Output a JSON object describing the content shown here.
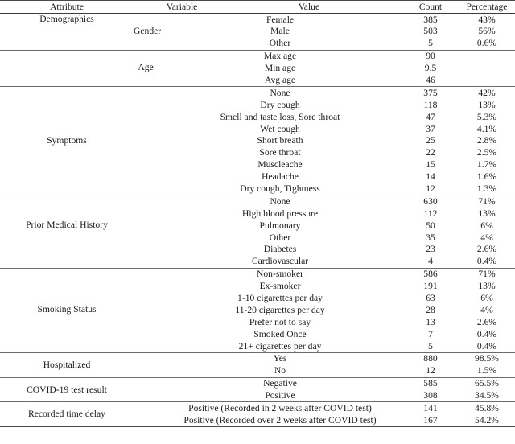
{
  "table": {
    "headers": [
      "Attribute",
      "Variable",
      "Value",
      "Count",
      "Percentage"
    ],
    "sections": [
      {
        "attribute": "Demographics",
        "attribute_row_index": 0,
        "groups": [
          {
            "variable": "Gender",
            "variable_row_index": 1,
            "rows": [
              {
                "value": "Female",
                "count": "385",
                "percentage": "43%"
              },
              {
                "value": "Male",
                "count": "503",
                "percentage": "56%"
              },
              {
                "value": "Other",
                "count": "5",
                "percentage": "0.6%"
              }
            ]
          }
        ]
      },
      {
        "attribute": "",
        "attribute_row_index": -1,
        "groups": [
          {
            "variable": "Age",
            "variable_row_index": 1,
            "rows": [
              {
                "value": "Max age",
                "count": "90",
                "percentage": ""
              },
              {
                "value": "Min age",
                "count": "9.5",
                "percentage": ""
              },
              {
                "value": "Avg age",
                "count": "46",
                "percentage": ""
              }
            ]
          }
        ]
      },
      {
        "attribute": "Symptoms",
        "attribute_row_index": 4,
        "groups": [
          {
            "variable": "",
            "variable_row_index": -1,
            "rows": [
              {
                "value": "None",
                "count": "375",
                "percentage": "42%"
              },
              {
                "value": "Dry cough",
                "count": "118",
                "percentage": "13%"
              },
              {
                "value": "Smell and taste loss, Sore throat",
                "count": "47",
                "percentage": "5.3%"
              },
              {
                "value": "Wet cough",
                "count": "37",
                "percentage": "4.1%"
              },
              {
                "value": "Short breath",
                "count": "25",
                "percentage": "2.8%"
              },
              {
                "value": "Sore throat",
                "count": "22",
                "percentage": "2.5%"
              },
              {
                "value": "Muscleache",
                "count": "15",
                "percentage": "1.7%"
              },
              {
                "value": "Headache",
                "count": "14",
                "percentage": "1.6%"
              },
              {
                "value": "Dry cough, Tightness",
                "count": "12",
                "percentage": "1.3%"
              }
            ]
          }
        ]
      },
      {
        "attribute": "Prior Medical History",
        "attribute_row_index": 2,
        "groups": [
          {
            "variable": "",
            "variable_row_index": -1,
            "rows": [
              {
                "value": "None",
                "count": "630",
                "percentage": "71%"
              },
              {
                "value": "High blood pressure",
                "count": "112",
                "percentage": "13%"
              },
              {
                "value": "Pulmonary",
                "count": "50",
                "percentage": "6%"
              },
              {
                "value": "Other",
                "count": "35",
                "percentage": "4%"
              },
              {
                "value": "Diabetes",
                "count": "23",
                "percentage": "2.6%"
              },
              {
                "value": "Cardiovascular",
                "count": "4",
                "percentage": "0.4%"
              }
            ]
          }
        ]
      },
      {
        "attribute": "Smoking Status",
        "attribute_row_index": 3,
        "groups": [
          {
            "variable": "",
            "variable_row_index": -1,
            "rows": [
              {
                "value": "Non-smoker",
                "count": "586",
                "percentage": "71%"
              },
              {
                "value": "Ex-smoker",
                "count": "191",
                "percentage": "13%"
              },
              {
                "value": "1-10 cigarettes per day",
                "count": "63",
                "percentage": "6%"
              },
              {
                "value": "11-20 cigarettes per day",
                "count": "28",
                "percentage": "4%"
              },
              {
                "value": "Prefer not to say",
                "count": "13",
                "percentage": "2.6%"
              },
              {
                "value": "Smoked Once",
                "count": "7",
                "percentage": "0.4%"
              },
              {
                "value": "21+ cigarettes per day",
                "count": "5",
                "percentage": "0.4%"
              }
            ]
          }
        ]
      },
      {
        "attribute": "Hospitalized",
        "attribute_row_index": 0,
        "attribute_span_center": true,
        "groups": [
          {
            "variable": "",
            "variable_row_index": -1,
            "rows": [
              {
                "value": "Yes",
                "count": "880",
                "percentage": "98.5%"
              },
              {
                "value": "No",
                "count": "12",
                "percentage": "1.5%"
              }
            ]
          }
        ]
      },
      {
        "attribute": "COVID-19 test result",
        "attribute_row_index": 0,
        "attribute_span_center": true,
        "groups": [
          {
            "variable": "",
            "variable_row_index": -1,
            "rows": [
              {
                "value": "Negative",
                "count": "585",
                "percentage": "65.5%"
              },
              {
                "value": "Positive",
                "count": "308",
                "percentage": "34.5%"
              }
            ]
          }
        ]
      },
      {
        "attribute": "Recorded time delay",
        "attribute_row_index": 0,
        "attribute_span_center": true,
        "groups": [
          {
            "variable": "",
            "variable_row_index": -1,
            "rows": [
              {
                "value": "Positive (Recorded in 2 weeks after COVID test)",
                "count": "141",
                "percentage": "45.8%"
              },
              {
                "value": "Positive (Recorded over 2 weeks after COVID test)",
                "count": "167",
                "percentage": "54.2%"
              }
            ]
          }
        ]
      }
    ]
  }
}
